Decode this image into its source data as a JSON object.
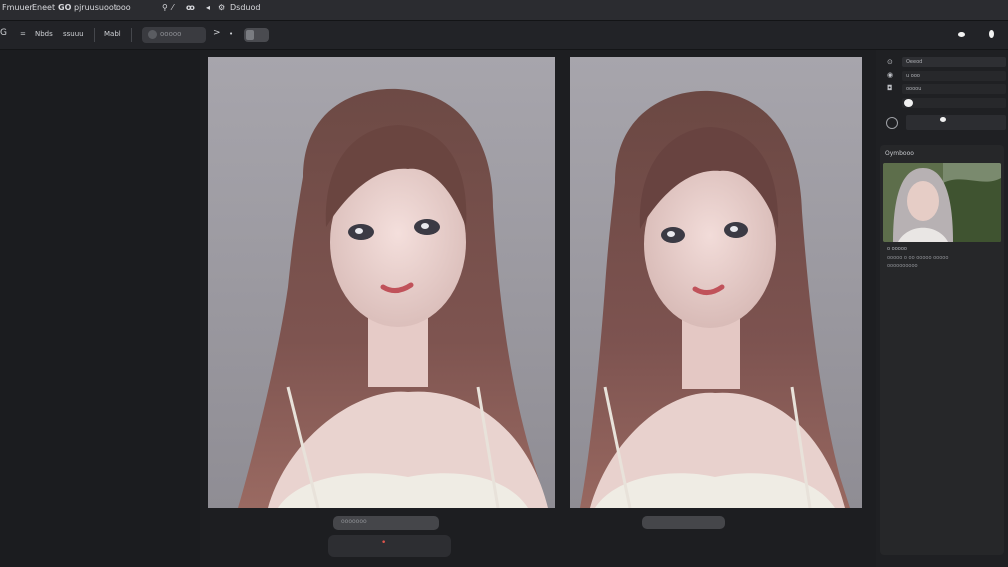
{
  "menubar": {
    "items": [
      "Fmuuer",
      "Eneet",
      "pjruusuoot",
      "ooo",
      "Dsduod"
    ],
    "brand_glyph": "GO"
  },
  "toolbar": {
    "items": [
      "G",
      "=",
      "Nbds",
      "ssuuu",
      "Mabl",
      "ooooo",
      ">",
      "•"
    ]
  },
  "right_panel": {
    "rows": [
      "Oeeod",
      "u ooo",
      "oooou",
      "u"
    ],
    "card_title": "Oymbooo",
    "thumb_caption": "o ooooo",
    "meta_lines": [
      "ooooo  o  oo  ooooo  ooooo",
      "oooooooooo"
    ]
  },
  "bottom": {
    "left_pill_text": "ooooooo",
    "dot_symbol": "•"
  },
  "colors": {
    "accent_dot": "#e0554d",
    "pane_bg": "#9e9ca3",
    "panel_bg": "#1d1e21"
  },
  "icons": [
    "menu-icon",
    "eye-icon",
    "arrow-icon",
    "pin-icon",
    "chevron-right-icon",
    "dot-icon",
    "gear-icon",
    "target-icon"
  ]
}
